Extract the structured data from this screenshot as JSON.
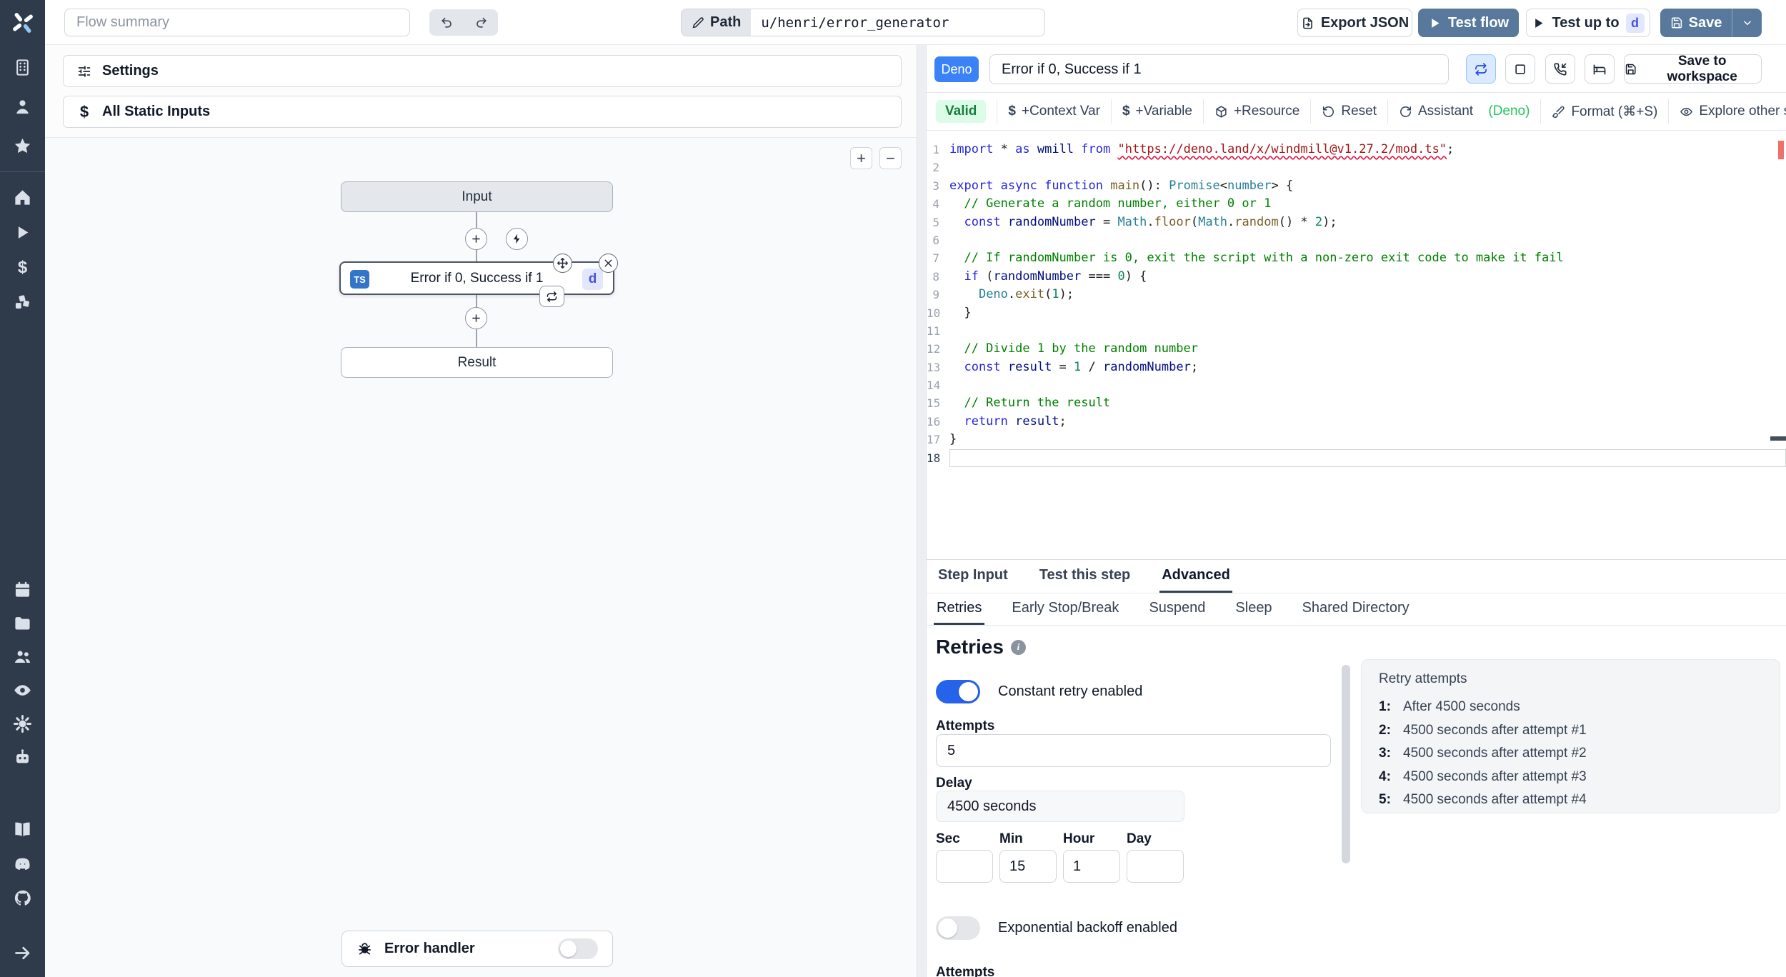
{
  "colors": {
    "accent": "#58799b",
    "deno_badge": "#3b82f6",
    "ts_badge": "#3575c7",
    "d_badge_bg": "#e0e7ff",
    "d_badge_fg": "#4752e0",
    "toggle_on": "#2563eb",
    "valid_bg": "#dcfce7",
    "valid_fg": "#15803d",
    "assistant_green": "#22c55e",
    "error_marker": "#e11d48",
    "tk_keyword": "#2626d9",
    "tk_type": "#267f99",
    "tk_function": "#795e26",
    "tk_ident": "#001080",
    "tk_string": "#a31515",
    "tk_comment": "#008000",
    "tk_number": "#098658"
  },
  "rail": {
    "groups": [
      [
        "building",
        "user",
        "star"
      ],
      [
        "home",
        "play",
        "dollar",
        "blocks"
      ],
      [
        "calendar",
        "folder",
        "users",
        "eye",
        "gear",
        "robot"
      ],
      [
        "book",
        "discord",
        "github"
      ],
      [
        "arrow-right"
      ]
    ]
  },
  "topbar": {
    "flow_summary_placeholder": "Flow summary",
    "path_label": "Path",
    "path_value": "u/henri/error_generator",
    "export_json": "Export JSON",
    "test_flow": "Test flow",
    "test_up_to": "Test up to",
    "test_up_to_badge": "d",
    "save": "Save"
  },
  "left_panel": {
    "settings": "Settings",
    "all_static_inputs": "All Static Inputs",
    "graph": {
      "input_node": "Input",
      "module": {
        "lang": "TS",
        "label": "Error if 0, Success if 1",
        "id": "d"
      },
      "result_node": "Result",
      "error_handler": "Error handler"
    }
  },
  "step_header": {
    "lang_badge": "Deno",
    "summary": "Error if 0, Success if 1",
    "save_to_workspace": "Save to workspace"
  },
  "toolbar": {
    "valid": "Valid",
    "context_var": "+Context Var",
    "variable": "+Variable",
    "resource": "+Resource",
    "reset": "Reset",
    "assistant": "Assistant",
    "assistant_lang": "(Deno)",
    "format": "Format (⌘+S)",
    "explore": "Explore other s"
  },
  "code": {
    "lines": [
      {
        "seg": [
          [
            "k",
            "import "
          ],
          [
            "p",
            "* "
          ],
          [
            "k",
            "as "
          ],
          [
            "i",
            "wmill "
          ],
          [
            "k",
            "from "
          ],
          [
            "e",
            "\"https://deno.land/x/windmill@v1.27.2/mod.ts\""
          ],
          [
            "p",
            ";"
          ]
        ]
      },
      {
        "seg": []
      },
      {
        "seg": [
          [
            "k",
            "export "
          ],
          [
            "k",
            "async "
          ],
          [
            "k",
            "function "
          ],
          [
            "f",
            "main"
          ],
          [
            "p",
            "(): "
          ],
          [
            "t",
            "Promise"
          ],
          [
            "p",
            "<"
          ],
          [
            "t",
            "number"
          ],
          [
            "p",
            "> {"
          ]
        ]
      },
      {
        "seg": [
          [
            "c",
            "  // Generate a random number, either 0 or 1"
          ]
        ]
      },
      {
        "seg": [
          [
            "k",
            "  const "
          ],
          [
            "i",
            "randomNumber"
          ],
          [
            "p",
            " = "
          ],
          [
            "t",
            "Math"
          ],
          [
            "p",
            "."
          ],
          [
            "f",
            "floor"
          ],
          [
            "p",
            "("
          ],
          [
            "t",
            "Math"
          ],
          [
            "p",
            "."
          ],
          [
            "f",
            "random"
          ],
          [
            "p",
            "() * "
          ],
          [
            "n",
            "2"
          ],
          [
            "p",
            ");"
          ]
        ]
      },
      {
        "seg": []
      },
      {
        "seg": [
          [
            "c",
            "  // If randomNumber is 0, exit the script with a non-zero exit code to make it fail"
          ]
        ]
      },
      {
        "seg": [
          [
            "k",
            "  if "
          ],
          [
            "p",
            "("
          ],
          [
            "i",
            "randomNumber"
          ],
          [
            "p",
            " === "
          ],
          [
            "n",
            "0"
          ],
          [
            "p",
            ") {"
          ]
        ]
      },
      {
        "seg": [
          [
            "p",
            "    "
          ],
          [
            "t",
            "Deno"
          ],
          [
            "p",
            "."
          ],
          [
            "f",
            "exit"
          ],
          [
            "p",
            "("
          ],
          [
            "n",
            "1"
          ],
          [
            "p",
            ");"
          ]
        ]
      },
      {
        "seg": [
          [
            "p",
            "  }"
          ]
        ]
      },
      {
        "seg": []
      },
      {
        "seg": [
          [
            "c",
            "  // Divide 1 by the random number"
          ]
        ]
      },
      {
        "seg": [
          [
            "k",
            "  const "
          ],
          [
            "i",
            "result"
          ],
          [
            "p",
            " = "
          ],
          [
            "n",
            "1"
          ],
          [
            "p",
            " / "
          ],
          [
            "i",
            "randomNumber"
          ],
          [
            "p",
            ";"
          ]
        ]
      },
      {
        "seg": []
      },
      {
        "seg": [
          [
            "c",
            "  // Return the result"
          ]
        ]
      },
      {
        "seg": [
          [
            "k",
            "  return "
          ],
          [
            "i",
            "result"
          ],
          [
            "p",
            ";"
          ]
        ]
      },
      {
        "seg": [
          [
            "p",
            "}"
          ]
        ]
      },
      {
        "seg": [],
        "current": true
      }
    ]
  },
  "tabs": {
    "main": [
      "Step Input",
      "Test this step",
      "Advanced"
    ],
    "main_active": 2,
    "sub": [
      "Retries",
      "Early Stop/Break",
      "Suspend",
      "Sleep",
      "Shared Directory"
    ],
    "sub_active": 0
  },
  "retries": {
    "title": "Retries",
    "constant_label": "Constant retry enabled",
    "attempts_label": "Attempts",
    "attempts_value": "5",
    "delay_label": "Delay",
    "delay_value": "4500 seconds",
    "time_fields": [
      {
        "label": "Sec",
        "value": ""
      },
      {
        "label": "Min",
        "value": "15"
      },
      {
        "label": "Hour",
        "value": "1"
      },
      {
        "label": "Day",
        "value": ""
      }
    ],
    "exponential_label": "Exponential backoff enabled",
    "next_section_label": "Attempts",
    "preview": {
      "title": "Retry attempts",
      "items": [
        {
          "n": "1:",
          "text": "After 4500 seconds"
        },
        {
          "n": "2:",
          "text": "4500 seconds after attempt #1"
        },
        {
          "n": "3:",
          "text": "4500 seconds after attempt #2"
        },
        {
          "n": "4:",
          "text": "4500 seconds after attempt #3"
        },
        {
          "n": "5:",
          "text": "4500 seconds after attempt #4"
        }
      ]
    }
  }
}
